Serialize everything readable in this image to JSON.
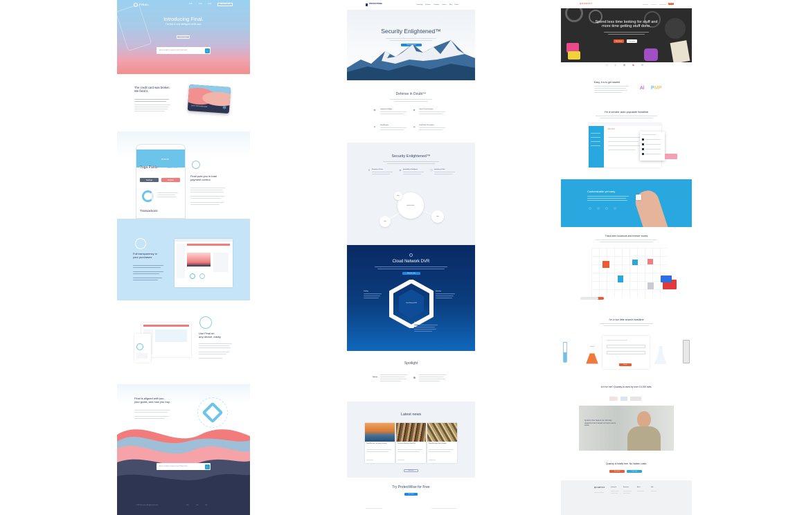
{
  "final": {
    "brand": "FINAL",
    "nav": [
      "Link",
      "Link",
      "Link"
    ],
    "nav_cta": "Get Final Card",
    "hero_title": "Introducing Final.",
    "hero_sub": "The first & only intelligent credit card.",
    "hero_btn": "Learn more",
    "email_placeholder": "Enter email to request your Final card...",
    "s1_title": "The credit card was broken.\nWe fixed it.",
    "card_name": "MATT RICHARDSON",
    "app_title": "Yoga Pants",
    "app_amount": "$33.99",
    "app_balance": "$749.33",
    "app_btn_settings": "Settings",
    "app_btn_disable": "Disable",
    "app_transactions": "Transactions",
    "s2_title": "Final puts you in total\npayment control.",
    "s3_title": "Full transparency in\nyour purchases",
    "s4_title": "Use Final on\nany device, easily.",
    "s5_title": "Final is aligned with you,\nyour goals, and how you buy.",
    "footer_left": "© 2014 Final Inc. All rights reserved."
  },
  "protectwise": {
    "brand": "PROTECTWISE",
    "nav": [
      "Technology",
      "Solutions",
      "Company",
      "Careers",
      "Blog",
      "Contact"
    ],
    "hero_title": "Security Enlightened™",
    "hero_btn": "Request a demo",
    "s1_title": "Defense in Doubt™",
    "features": [
      "Unmatched Visibility",
      "Time & Threat Narrative",
      "Deep Analysis",
      "Cloud Scale & Economics"
    ],
    "s2_title": "Security Enlightened™",
    "pillars": [
      "Economics of Scale",
      "Immutability of Intelligence",
      "Immediacy of Value"
    ],
    "bubble_main": "protectwise",
    "bubble_a": "data",
    "bubble_b": "data",
    "bubble_c": "data",
    "s3_title": "Cloud Network DVR",
    "s3_btn": "Watch the video",
    "hex_center": "Cloud Network DVR",
    "hex_label_left": "Visibility",
    "hex_label_right": "Retention",
    "hex_label_bottom": "Simplicity",
    "s4_title": "Spotlight",
    "spotlight_label": "Gartner",
    "s5_title": "Latest news",
    "news": [
      "ProtectWise wins Cool Vendor in Security",
      "The Future of Security Is Cloud DVR",
      "ProtectWise raises Series B funding"
    ],
    "news_btn": "More news",
    "s6_title": "Try ProtectWise for Free",
    "s6_btn": "Get started"
  },
  "quartzy": {
    "brand": "QUARTZY",
    "nav_cta": "Sign up",
    "hero_title": "Spend less time looking for stuff and\nmore time getting stuff done.",
    "hero_btn1": "Get started",
    "hero_btn2": "Learn more",
    "s1_title": "Easy, it is to get started",
    "logo_a": "Al",
    "logo_b": "P",
    "logo_c": "MP",
    "s2_title": "I'm a vendor auto populate headline",
    "app_item": "Item Item",
    "s3_title": "Customizable yet easy",
    "s4_title": "Track item locations and freezer boxes",
    "s5_title": "I'm a fun little search headline",
    "s5_btn": "Search",
    "s6_title": "Is it for me? Quartzy is used by over 10,000 labs.",
    "quote": "Quartzy has helped our lab stay organized and saved us hours every week.",
    "s7_title": "Quartzy is totally free. No hidden costs.",
    "s7_btn1": "Get started",
    "s7_btn2": "Learn more",
    "footer_brand": "QUARTZY",
    "footer_cols": [
      "Quartzy for",
      "Resources",
      "About",
      "Help"
    ]
  },
  "colors": {
    "final_navy": "#2d3553",
    "final_coral": "#f27c7c",
    "final_sky": "#c6e4f7",
    "pw_blue": "#0b4a8e",
    "pw_cta": "#1e88e5",
    "qz_orange": "#ee5a2f",
    "qz_blue": "#29a8e0"
  }
}
